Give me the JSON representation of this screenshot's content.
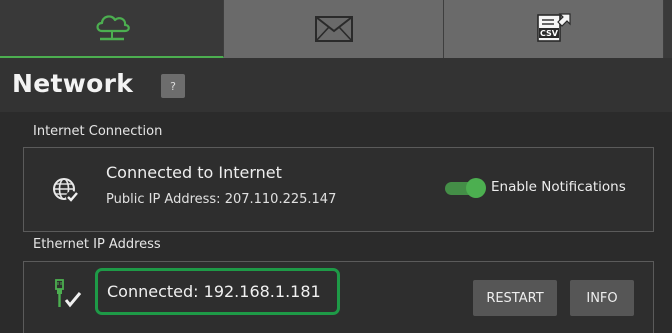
{
  "tabs": [
    {
      "name": "cloud",
      "icon": "cloud-icon",
      "active": true
    },
    {
      "name": "mail",
      "icon": "mail-icon",
      "active": false
    },
    {
      "name": "csv",
      "icon": "csv-export-icon",
      "active": false
    }
  ],
  "header": {
    "title": "Network",
    "help_label": "?"
  },
  "internet": {
    "section_label": "Internet Connection",
    "icon": "globe-check-icon",
    "status": "Connected to Internet",
    "public_ip": "Public IP Address: 207.110.225.147",
    "notifications_label": "Enable Notifications",
    "notifications_enabled": true
  },
  "ethernet": {
    "section_label": "Ethernet IP Address",
    "icon": "ethernet-check-icon",
    "status": "Connected: 192.168.1.181",
    "restart_label": "RESTART",
    "info_label": "INFO"
  },
  "colors": {
    "accent": "#4caf50",
    "highlight_border": "#1e9a47",
    "background": "#2b2b2b"
  }
}
